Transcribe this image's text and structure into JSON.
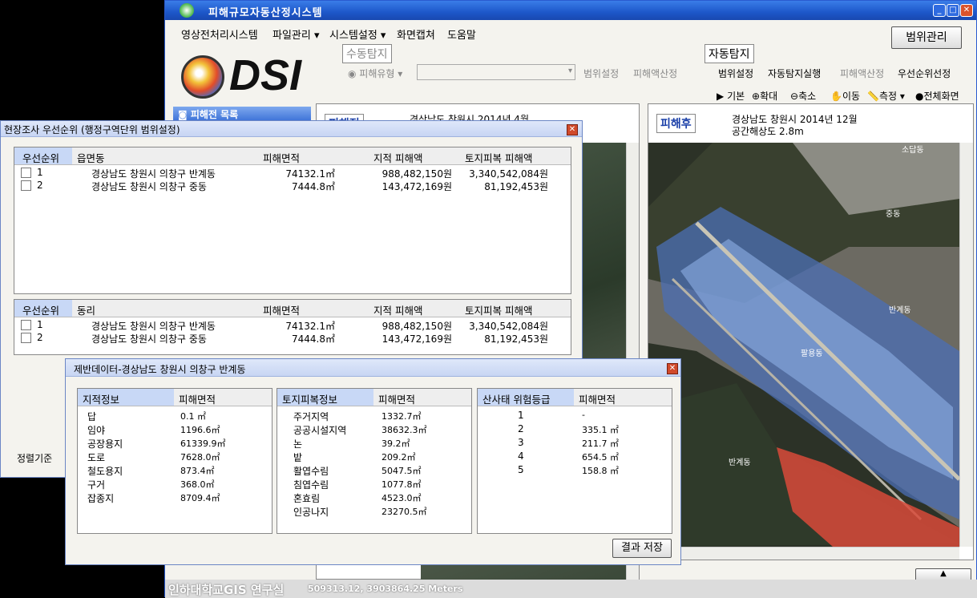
{
  "app": {
    "title": "피해규모자동산정시스템"
  },
  "menu": [
    "영상전처리시스템",
    "파일관리 ▾",
    "시스템설정 ▾",
    "화면캡쳐",
    "도움말"
  ],
  "range_button": "범위관리",
  "logo_text": "DSI",
  "manual": {
    "label": "수동탐지",
    "damage_type": "피해유형",
    "range_set": "범위설정",
    "damage_calc": "피해액산정"
  },
  "auto": {
    "label": "자동탐지",
    "range_set": "범위설정",
    "auto_run": "자동탐지실행",
    "damage_calc": "피해액산정",
    "priority": "우선순위선정"
  },
  "tools": [
    "기본",
    "확대",
    "축소",
    "이동",
    "측정",
    "전체화면"
  ],
  "left_tab": "피해전 목록",
  "before": {
    "badge": "피해전",
    "caption": "경상남도 창원시 2014년 4월"
  },
  "after": {
    "badge": "피해후",
    "caption1": "경상남도 창원시 2014년 12월",
    "caption2": "공간해상도 2.8m",
    "map_labels": [
      "소답동",
      "중동",
      "반계동",
      "팔용동",
      "반계동"
    ]
  },
  "status": {
    "org": "인하대학교GIS 연구실",
    "coords": "509313.12, 3903864.25  Meters"
  },
  "priority_dlg": {
    "title": "현장조사 우선순위 (행정구역단위 범위설정)",
    "headers1": [
      "우선순위",
      "읍면동",
      "피해면적",
      "지적 피해액",
      "토지피복 피해액"
    ],
    "rows1": [
      [
        "1",
        "경상남도 창원시 의창구 반계동",
        "74132.1㎡",
        "988,482,150원",
        "3,340,542,084원"
      ],
      [
        "2",
        "경상남도 창원시 의창구 중동",
        "7444.8㎡",
        "143,472,169원",
        "81,192,453원"
      ]
    ],
    "headers2": [
      "우선순위",
      "동리",
      "피해면적",
      "지적 피해액",
      "토지피복 피해액"
    ],
    "rows2": [
      [
        "1",
        "경상남도 창원시 의창구 반계동",
        "74132.1㎡",
        "988,482,150원",
        "3,340,542,084원"
      ],
      [
        "2",
        "경상남도 창원시 의창구 중동",
        "7444.8㎡",
        "143,472,169원",
        "81,192,453원"
      ]
    ],
    "sort_label": "정렬기준"
  },
  "general_dlg": {
    "title": "제반데이터-경상남도 창원시 의창구 반계동",
    "cadastral": {
      "headers": [
        "지적정보",
        "피해면적"
      ],
      "rows": [
        [
          "답",
          "0.1 ㎡"
        ],
        [
          "임야",
          "1196.6㎡"
        ],
        [
          "공장용지",
          "61339.9㎡"
        ],
        [
          "도로",
          "7628.0㎡"
        ],
        [
          "철도용지",
          "873.4㎡"
        ],
        [
          "구거",
          "368.0㎡"
        ],
        [
          "잡종지",
          "8709.4㎡"
        ]
      ]
    },
    "landcover": {
      "headers": [
        "토지피복정보",
        "피해면적"
      ],
      "rows": [
        [
          "주거지역",
          "1332.7㎡"
        ],
        [
          "공공시설지역",
          "38632.3㎡"
        ],
        [
          "논",
          "39.2㎡"
        ],
        [
          "밭",
          "209.2㎡"
        ],
        [
          "활엽수림",
          "5047.5㎡"
        ],
        [
          "침엽수림",
          "1077.8㎡"
        ],
        [
          "혼효림",
          "4523.0㎡"
        ],
        [
          "인공나지",
          "23270.5㎡"
        ]
      ]
    },
    "landslide": {
      "headers": [
        "산사태 위험등급",
        "피해면적"
      ],
      "rows": [
        [
          "1",
          "-"
        ],
        [
          "2",
          "335.1 ㎡"
        ],
        [
          "3",
          "211.7 ㎡"
        ],
        [
          "4",
          "654.5 ㎡"
        ],
        [
          "5",
          "158.8 ㎡"
        ]
      ]
    },
    "save_button": "결과 저장"
  }
}
